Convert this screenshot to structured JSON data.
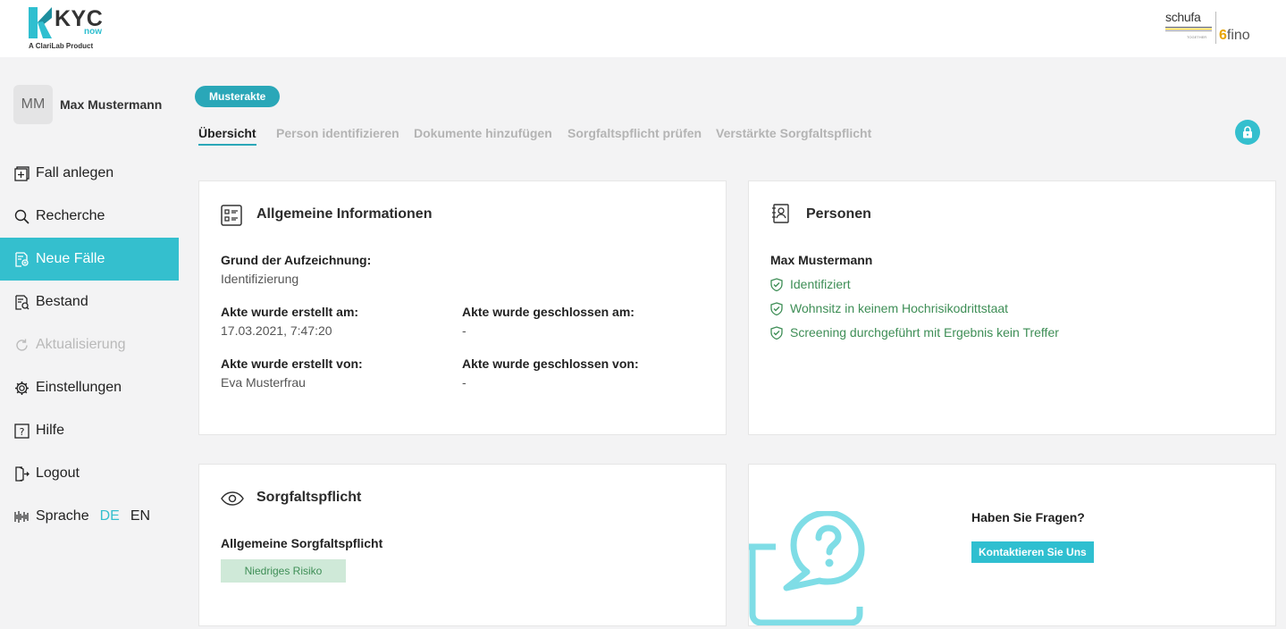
{
  "brand": {
    "logo_main": "KYC",
    "logo_now": "now",
    "logo_sub": "A ClariLab Product",
    "partner_schufa": "schufa",
    "partner_together": "TOGETHER",
    "partner_fino": "fino",
    "accent_color": "#34bfce"
  },
  "user": {
    "initials": "MM",
    "name": "Max Mustermann"
  },
  "sidebar": {
    "items": [
      {
        "label": "Fall anlegen",
        "icon": "add-square-icon"
      },
      {
        "label": "Recherche",
        "icon": "search-icon"
      },
      {
        "label": "Neue Fälle",
        "icon": "new-cases-icon",
        "active": true
      },
      {
        "label": "Bestand",
        "icon": "inventory-icon"
      },
      {
        "label": "Aktualisierung",
        "icon": "refresh-icon",
        "disabled": true
      },
      {
        "label": "Einstellungen",
        "icon": "gear-icon"
      },
      {
        "label": "Hilfe",
        "icon": "help-icon"
      },
      {
        "label": "Logout",
        "icon": "logout-icon"
      }
    ],
    "language": {
      "label": "Sprache",
      "de": "DE",
      "en": "EN",
      "icon": "language-icon"
    }
  },
  "main": {
    "badge": "Musterakte",
    "tabs": [
      {
        "label": "Übersicht",
        "active": true
      },
      {
        "label": "Person identifizieren"
      },
      {
        "label": "Dokumente hinzufügen"
      },
      {
        "label": "Sorgfaltspflicht prüfen"
      },
      {
        "label": "Verstärkte Sorgfaltspflicht"
      }
    ]
  },
  "general_info": {
    "title": "Allgemeine Informationen",
    "reason_label": "Grund der Aufzeichnung:",
    "reason_value": "Identifizierung",
    "created_at_label": "Akte wurde erstellt am:",
    "created_at_value": "17.03.2021, 7:47:20",
    "closed_at_label": "Akte wurde geschlossen am:",
    "closed_at_value": "-",
    "created_by_label": "Akte wurde erstellt von:",
    "created_by_value": "Eva Musterfrau",
    "closed_by_label": "Akte wurde geschlossen von:",
    "closed_by_value": "-"
  },
  "persons": {
    "title": "Personen",
    "name": "Max Mustermann",
    "checks": [
      "Identifiziert",
      "Wohnsitz in keinem Hochrisikodrittstaat",
      "Screening durchgeführt mit Ergebnis kein Treffer"
    ]
  },
  "due_diligence": {
    "title": "Sorgfaltspflicht",
    "subtitle": "Allgemeine Sorgfaltspflicht",
    "risk": "Niedriges Risiko"
  },
  "help": {
    "question": "Haben Sie Fragen?",
    "button": "Kontaktieren Sie Uns"
  }
}
